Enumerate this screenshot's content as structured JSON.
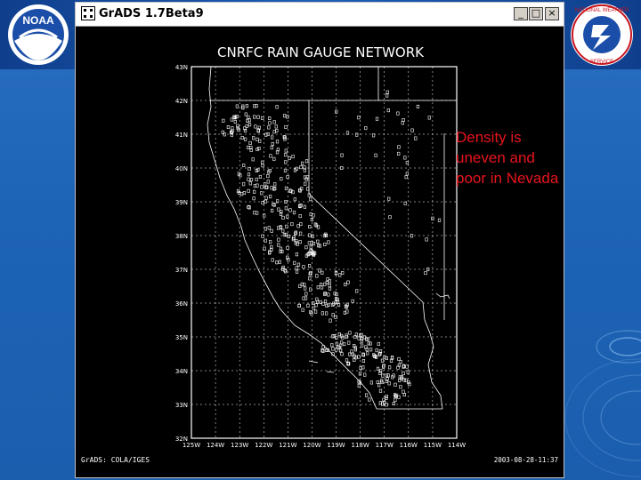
{
  "window": {
    "title": "GrADS 1.7Beta9",
    "minimize_glyph": "_",
    "maximize_glyph": "□",
    "close_glyph": "×"
  },
  "logos": {
    "left": "noaa-logo",
    "right": "nws-logo"
  },
  "plot": {
    "title": "CNRFC RAIN GAUGE NETWORK",
    "lat_labels": [
      "43N",
      "42N",
      "41N",
      "40N",
      "39N",
      "38N",
      "37N",
      "36N",
      "35N",
      "34N",
      "33N",
      "32N"
    ],
    "lon_labels": [
      "125W",
      "124W",
      "123W",
      "122W",
      "121W",
      "120W",
      "119W",
      "118W",
      "117W",
      "116W",
      "115W",
      "114W"
    ],
    "footer_left": "GrADS: COLA/IGES",
    "footer_right": "2003-08-28-11:37",
    "colors": {
      "background": "#000000",
      "foreground": "#ffffff"
    }
  },
  "annotation": {
    "lines": [
      "Density is",
      "uneven and",
      "poor in Nevada"
    ],
    "color": "#e8141e"
  }
}
